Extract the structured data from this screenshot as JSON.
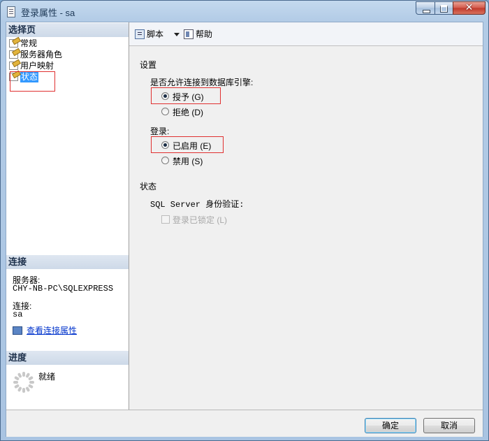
{
  "window": {
    "title": "登录属性 - sa"
  },
  "caption_buttons": {
    "close_glyph": "✕"
  },
  "left_pane": {
    "select_page_header": "选择页",
    "nav_items": [
      {
        "label": "常规",
        "selected": false
      },
      {
        "label": "服务器角色",
        "selected": false
      },
      {
        "label": "用户映射",
        "selected": false
      },
      {
        "label": "状态",
        "selected": true
      }
    ],
    "connection_header": "连接",
    "server_label": "服务器:",
    "server_value": "CHY-NB-PC\\SQLEXPRESS",
    "connection_label": "连接:",
    "connection_value": "sa",
    "view_connection_link": "查看连接属性",
    "progress_header": "进度",
    "progress_status": "就绪"
  },
  "toolbar": {
    "script_label": "脚本",
    "help_label": "帮助"
  },
  "content": {
    "settings_header": "设置",
    "db_engine_question": "是否允许连接到数据库引擎:",
    "grant_label": "授予 (G)",
    "deny_label": "拒绝 (D)",
    "db_engine_selected": "grant",
    "login_label": "登录:",
    "enabled_label": "已启用 (E)",
    "disabled_label": "禁用 (S)",
    "login_selected": "enabled",
    "status_header": "状态",
    "sql_auth_label": "SQL Server 身份验证:",
    "locked_label": "登录已锁定 (L)",
    "locked_checked": false
  },
  "buttons": {
    "ok": "确定",
    "cancel": "取消"
  },
  "colors": {
    "selection": "#3399ff",
    "highlight_box": "#e03030",
    "link": "#0033cc"
  }
}
